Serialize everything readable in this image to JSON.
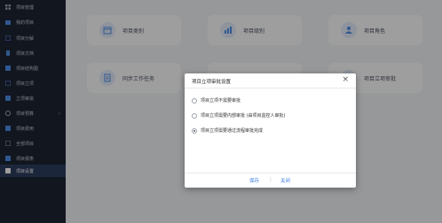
{
  "sidebar": {
    "items": [
      {
        "label": "项目管理",
        "icon": "grid-icon",
        "active": false,
        "has_arrow": false
      },
      {
        "label": "我的项目",
        "icon": "folder-icon",
        "active": false,
        "has_arrow": false
      },
      {
        "label": "项目分解",
        "icon": "tree-icon",
        "active": false,
        "has_arrow": false
      },
      {
        "label": "项目文档",
        "icon": "document-icon",
        "active": false,
        "has_arrow": false
      },
      {
        "label": "项目结构图",
        "icon": "structure-icon",
        "active": false,
        "has_arrow": false
      },
      {
        "label": "项目立项",
        "icon": "flag-icon",
        "active": false,
        "has_arrow": false
      },
      {
        "label": "立项审批",
        "icon": "check-icon",
        "active": false,
        "has_arrow": false
      },
      {
        "label": "项目预算",
        "icon": "money-icon",
        "active": false,
        "has_arrow": true
      },
      {
        "label": "项目费用",
        "icon": "receipt-icon",
        "active": false,
        "has_arrow": false
      },
      {
        "label": "全部项目",
        "icon": "list-icon",
        "active": false,
        "has_arrow": false
      },
      {
        "label": "项目报表",
        "icon": "chart-icon",
        "active": false,
        "has_arrow": false
      },
      {
        "label": "项目设置",
        "icon": "settings-icon",
        "active": true,
        "has_arrow": false
      }
    ]
  },
  "cards": [
    {
      "label": "项目类别",
      "icon": "calendar-icon"
    },
    {
      "label": "项目级别",
      "icon": "bar-chart-icon"
    },
    {
      "label": "项目角色",
      "icon": "user-icon"
    },
    {
      "label": "同步工作任务",
      "icon": "task-list-icon"
    },
    {
      "label": "",
      "icon": "blank"
    },
    {
      "label": "项目立项审批",
      "icon": "flag-icon"
    }
  ],
  "dialog": {
    "title": "项目立项审批设置",
    "close": "×",
    "options": [
      {
        "label": "项目立项不需要审批",
        "checked": false
      },
      {
        "label": "项目立项需要内部审批 (由项目监控人审批)",
        "checked": false
      },
      {
        "label": "项目立项需要通过流程审批完成",
        "checked": true
      }
    ],
    "save_label": "保存",
    "separator": "|",
    "close_label": "关闭"
  }
}
